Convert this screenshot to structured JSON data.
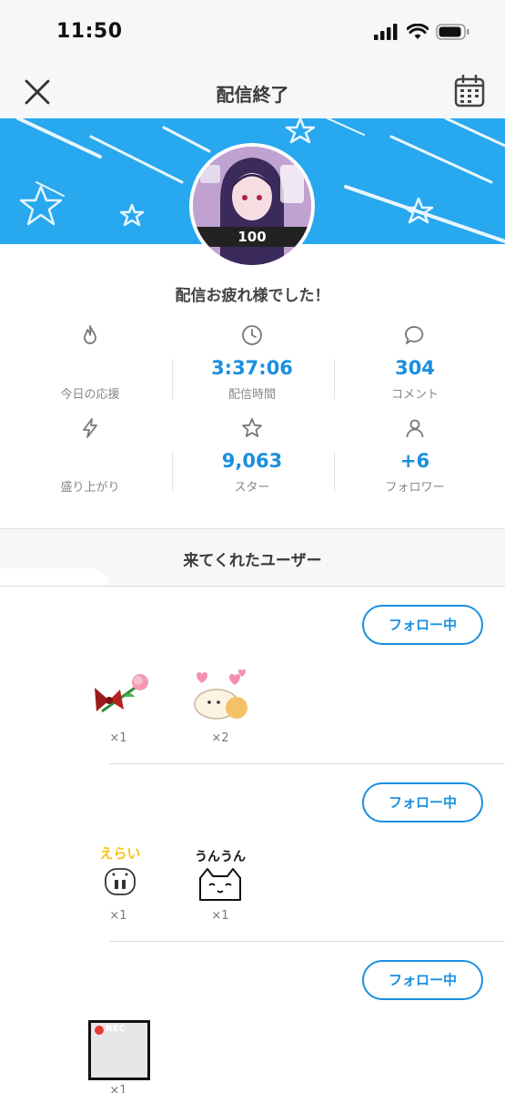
{
  "status_bar": {
    "time": "11:50"
  },
  "header": {
    "title": "配信終了"
  },
  "banner": {
    "color": "#27a8ef",
    "avatar_text": "100"
  },
  "headline": "配信お疲れ様でした！",
  "stats": [
    {
      "icon": "fire-icon",
      "value": "",
      "label": "今日の応援"
    },
    {
      "icon": "clock-icon",
      "value": "3:37:06",
      "label": "配信時間"
    },
    {
      "icon": "comment-icon",
      "value": "304",
      "label": "コメント"
    },
    {
      "icon": "bolt-icon",
      "value": "",
      "label": "盛り上がり"
    },
    {
      "icon": "star-icon",
      "value": "9,063",
      "label": "スター"
    },
    {
      "icon": "person-icon",
      "value": "+6",
      "label": "フォロワー"
    }
  ],
  "section": {
    "title": "来てくれたユーザー"
  },
  "users": [
    {
      "follow_label": "フォロー中",
      "gifts": [
        {
          "name": "rose",
          "count": "×1"
        },
        {
          "name": "cat-hearts",
          "count": "×2"
        }
      ]
    },
    {
      "follow_label": "フォロー中",
      "gifts": [
        {
          "name": "erai-pig",
          "count": "×1",
          "text": "えらい"
        },
        {
          "name": "unun-cat",
          "count": "×1",
          "text": "うんうん"
        }
      ]
    },
    {
      "follow_label": "フォロー中",
      "gifts": [
        {
          "name": "rec-frame",
          "count": "×1",
          "text": "REC"
        }
      ]
    }
  ],
  "colors": {
    "accent": "#1a8fe0",
    "banner": "#27a8ef"
  }
}
